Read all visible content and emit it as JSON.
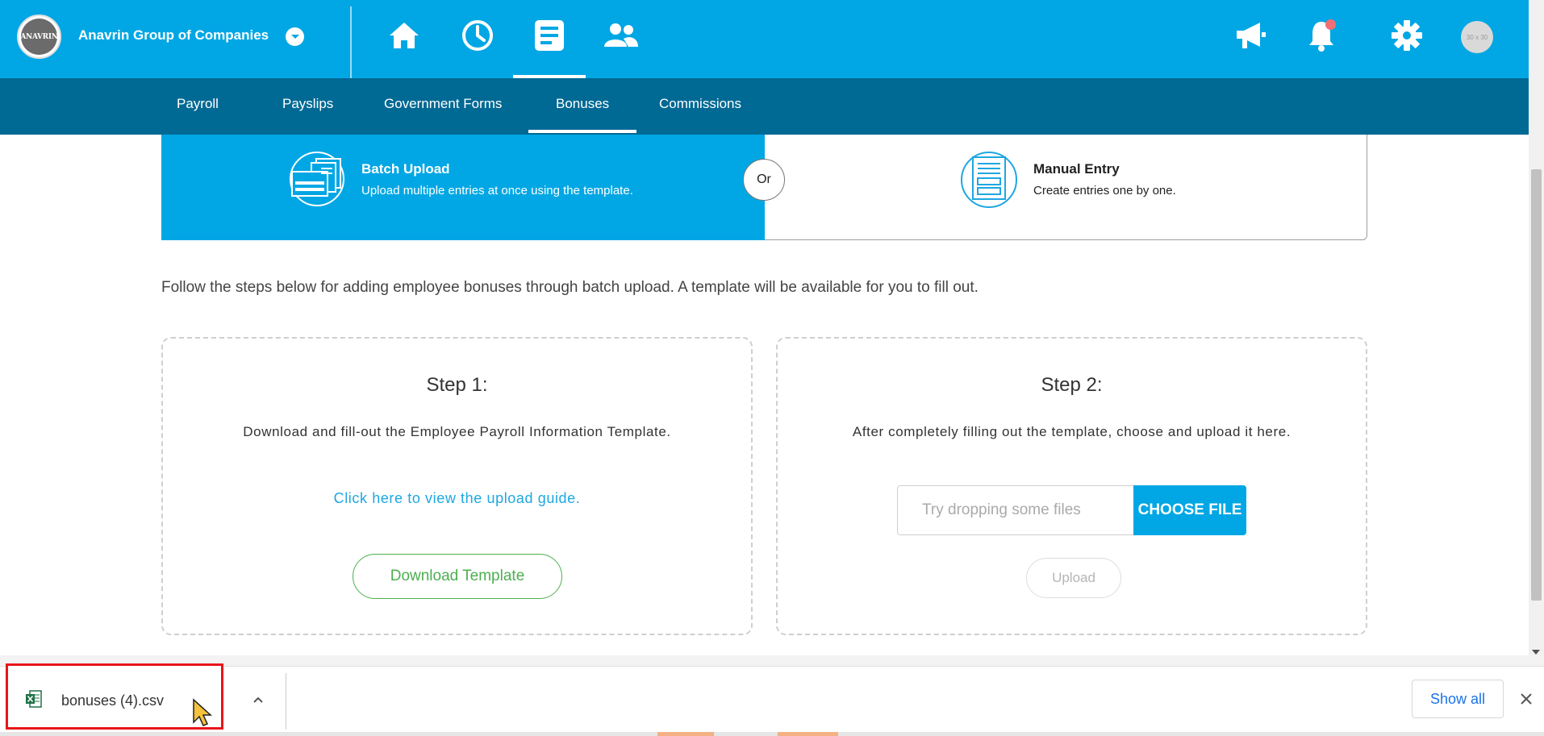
{
  "header": {
    "company_name": "Anavrin Group of Companies",
    "logo_text": "ANAVRIN",
    "avatar_text": "30 x 30",
    "nav_icons": [
      "home-icon",
      "clock-icon",
      "document-icon",
      "people-icon"
    ],
    "right_icons": [
      "megaphone-icon",
      "bell-icon",
      "gear-icon"
    ],
    "active_nav": "document-icon"
  },
  "subnav": {
    "items": [
      "Payroll",
      "Payslips",
      "Government Forms",
      "Bonuses",
      "Commissions"
    ],
    "active": "Bonuses"
  },
  "method": {
    "batch_title": "Batch Upload",
    "batch_desc": "Upload multiple entries at once using the template.",
    "or_label": "Or",
    "manual_title": "Manual Entry",
    "manual_desc": "Create entries one by one."
  },
  "instructions": "Follow the steps below for adding employee bonuses through batch upload. A template will be available for you to fill out.",
  "step1": {
    "title": "Step 1:",
    "text": "Download and fill-out the Employee Payroll Information Template.",
    "guide_link": "Click here to view the upload guide.",
    "download_label": "Download Template"
  },
  "step2": {
    "title": "Step 2:",
    "text": "After completely filling out the template, choose and upload it here.",
    "file_placeholder": "Try dropping some files",
    "choose_label": "CHOOSE FILE",
    "upload_label": "Upload"
  },
  "download_shelf": {
    "filename": "bonuses (4).csv",
    "show_all_label": "Show all"
  },
  "colors": {
    "primary": "#00a7e4",
    "subnav": "#006994",
    "success": "#4caf50",
    "highlight": "#e8151a"
  }
}
